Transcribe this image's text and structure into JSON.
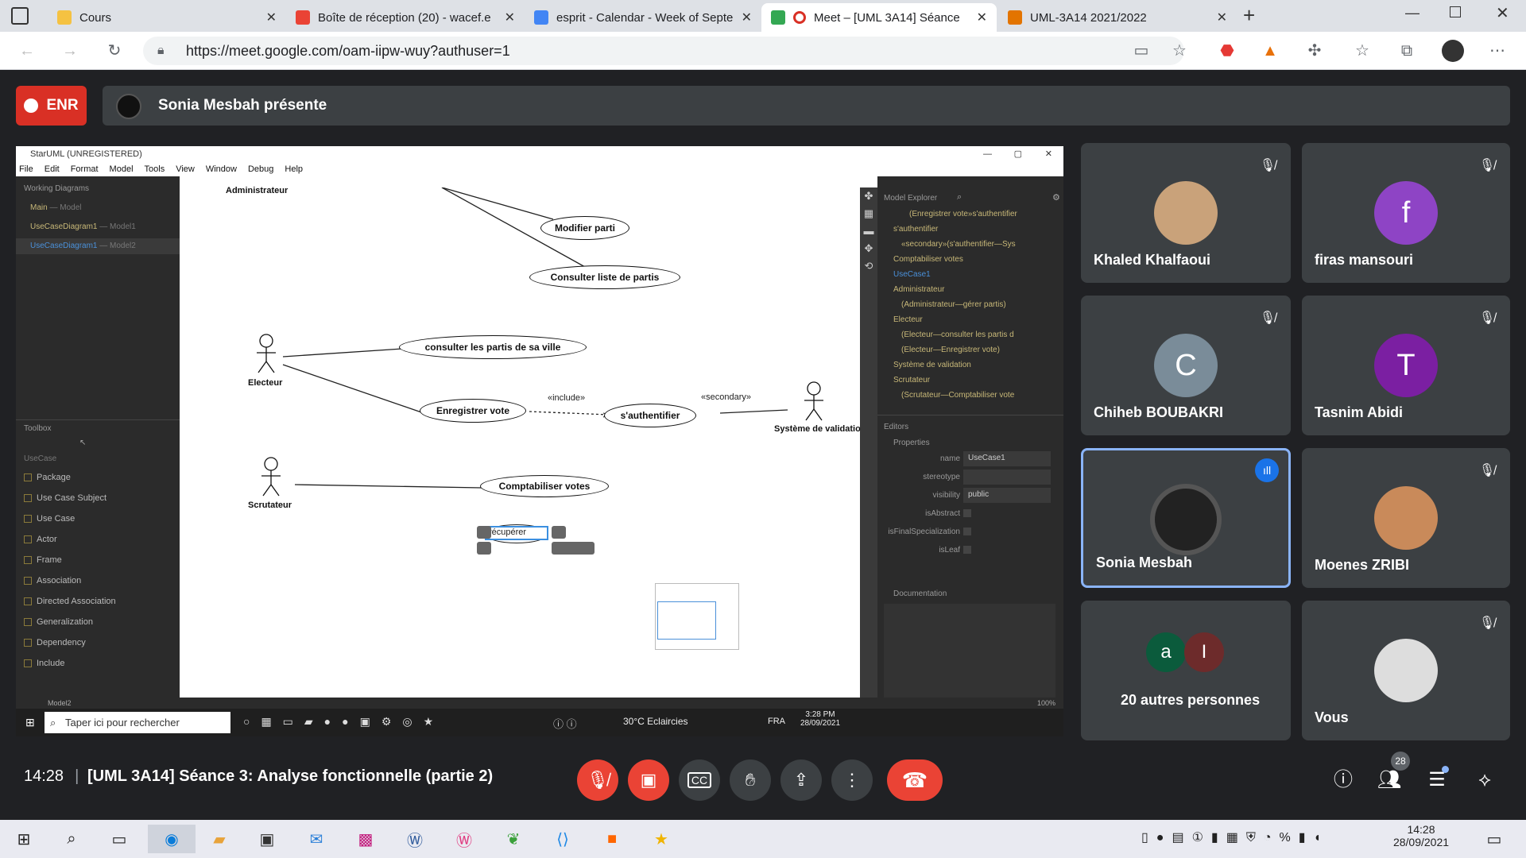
{
  "browser": {
    "tabs": [
      {
        "title": "Cours",
        "color": "#f5c242"
      },
      {
        "title": "Boîte de réception (20) - wacef.e",
        "color": "#ea4335"
      },
      {
        "title": "esprit - Calendar - Week of Septe",
        "color": "#4285f4"
      },
      {
        "title": "Meet – [UML 3A14] Séance",
        "color": "#34a853"
      },
      {
        "title": "UML-3A14 2021/2022",
        "color": "#e37400"
      }
    ],
    "url": "https://meet.google.com/oam-iipw-wuy?authuser=1"
  },
  "meet": {
    "rec_label": "ENR",
    "presenting": "Sonia Mesbah présente",
    "clock": "14:28",
    "meeting_title": "[UML 3A14] Séance 3: Analyse fonctionnelle (partie 2)",
    "participant_count": "28",
    "participants": [
      {
        "name": "Khaled Khalfaoui",
        "initial": "",
        "color": "#c9a27a",
        "muted": true
      },
      {
        "name": "firas mansouri",
        "initial": "f",
        "color": "#8e44c5",
        "muted": true
      },
      {
        "name": "Chiheb BOUBAKRI",
        "initial": "C",
        "color": "#7a8c99",
        "muted": true
      },
      {
        "name": "Tasnim Abidi",
        "initial": "T",
        "color": "#7b1fa2",
        "muted": true
      },
      {
        "name": "Sonia Mesbah",
        "initial": "",
        "color": "#222",
        "muted": false
      },
      {
        "name": "Moenes ZRIBI",
        "initial": "",
        "color": "#c98a5a",
        "muted": true
      },
      {
        "name": "20 autres personnes",
        "initial": "a",
        "initial2": "I",
        "color": "#0b5b3c",
        "color2": "#6d2b2b"
      },
      {
        "name": "Vous",
        "initial": "",
        "color": "#ddd",
        "muted": true
      }
    ]
  },
  "shared": {
    "window_title": "StarUML (UNREGISTERED)",
    "menu": [
      "File",
      "Edit",
      "Format",
      "Model",
      "Tools",
      "View",
      "Window",
      "Debug",
      "Help"
    ],
    "working_diagrams_title": "Working Diagrams",
    "working_diagrams": [
      {
        "name": "Main",
        "sub": "— Model"
      },
      {
        "name": "UseCaseDiagram1",
        "sub": "— Model1"
      },
      {
        "name": "UseCaseDiagram1",
        "sub": "— Model2"
      }
    ],
    "toolbox_title": "Toolbox",
    "toolbox_section": "UseCase",
    "toolbox": [
      "Package",
      "Use Case Subject",
      "Use Case",
      "Actor",
      "Frame",
      "Association",
      "Directed Association",
      "Generalization",
      "Dependency",
      "Include"
    ],
    "diagram": {
      "actors": [
        "Administrateur",
        "Electeur",
        "Système de validation",
        "Scrutateur"
      ],
      "usecases": [
        "Modifier parti",
        "Consulter liste de partis",
        "consulter les partis de sa ville",
        "Enregistrer vote",
        "s'authentifier",
        "Comptabiliser votes"
      ],
      "stereotypes": [
        "«include»",
        "«secondary»"
      ],
      "editing_value": "récupérer"
    },
    "model_explorer_title": "Model Explorer",
    "model_explorer": [
      "(Enregistrer vote»s'authentifier",
      "s'authentifier",
      "«secondary»(s'authentifier—Sys",
      "Comptabiliser votes",
      "UseCase1",
      "Administrateur",
      "(Administrateur—gérer partis)",
      "Electeur",
      "(Electeur—consulter les partis d",
      "(Electeur—Enregistrer vote)",
      "Système de validation",
      "Scrutateur",
      "(Scrutateur—Comptabiliser vote"
    ],
    "editors_title": "Editors",
    "properties_title": "Properties",
    "properties": [
      {
        "label": "name",
        "value": "UseCase1"
      },
      {
        "label": "stereotype",
        "value": ""
      },
      {
        "label": "visibility",
        "value": "public"
      },
      {
        "label": "isAbstract",
        "value": ""
      },
      {
        "label": "isFinalSpecialization",
        "value": ""
      },
      {
        "label": "isLeaf",
        "value": ""
      }
    ],
    "documentation_title": "Documentation",
    "status_left": "Model2",
    "status_zoom": "100%",
    "inner_taskbar": {
      "search": "Taper ici pour rechercher",
      "weather": "30°C Eclaircies",
      "lang": "FRA",
      "time": "3:28 PM",
      "date": "28/09/2021"
    }
  },
  "windows": {
    "time": "14:28",
    "date": "28/09/2021"
  }
}
